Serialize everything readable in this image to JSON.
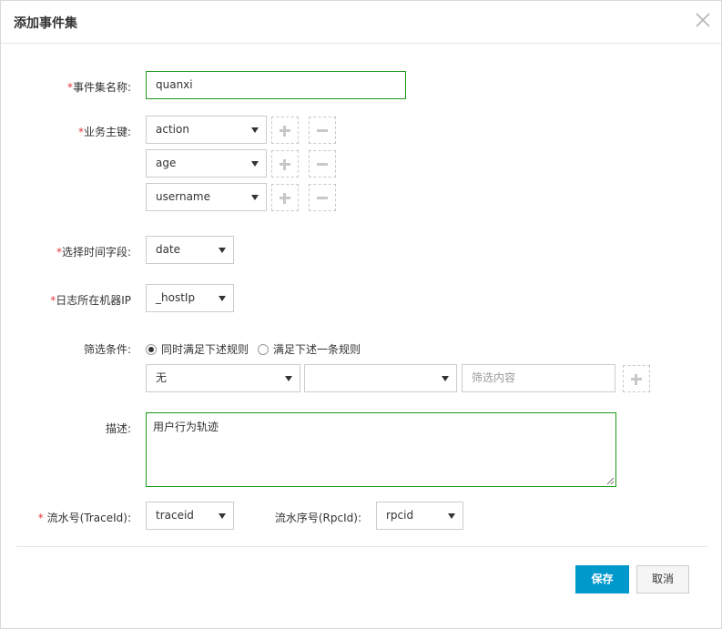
{
  "dialog": {
    "title": "添加事件集"
  },
  "form": {
    "event_set_name": {
      "required_mark": "*",
      "label": "事件集名称:",
      "value": "quanxi"
    },
    "business_keys": {
      "required_mark": "*",
      "label": "业务主键:",
      "rows": [
        {
          "value": "action"
        },
        {
          "value": "age"
        },
        {
          "value": "username"
        }
      ]
    },
    "time_field": {
      "required_mark": "*",
      "label": "选择时间字段:",
      "value": "date"
    },
    "log_machine_ip": {
      "required_mark": "*",
      "label": "日志所在机器IP",
      "value": "_hostIp"
    },
    "filter": {
      "label": "筛选条件:",
      "options": [
        {
          "label": "同时满足下述规则",
          "selected": true
        },
        {
          "label": "满足下述一条规则",
          "selected": false
        }
      ],
      "field_value": "无",
      "operator_value": "",
      "content_placeholder": "筛选内容"
    },
    "description": {
      "label": "描述:",
      "value": "用户行为轨迹"
    },
    "trace_id": {
      "required_mark": "*",
      "label": " 流水号(TraceId):",
      "value": "traceid"
    },
    "rpc_id": {
      "label": "流水序号(RpcId):",
      "value": "rpcid"
    }
  },
  "footer": {
    "save_label": "保存",
    "cancel_label": "取消"
  },
  "icons": {
    "close": "close-icon",
    "add": "plus-icon",
    "remove": "minus-icon",
    "dropdown": "caret-down-icon"
  },
  "colors": {
    "primary": "#0099cc",
    "required": "#e4393c",
    "active_border": "#1a9a1a"
  }
}
